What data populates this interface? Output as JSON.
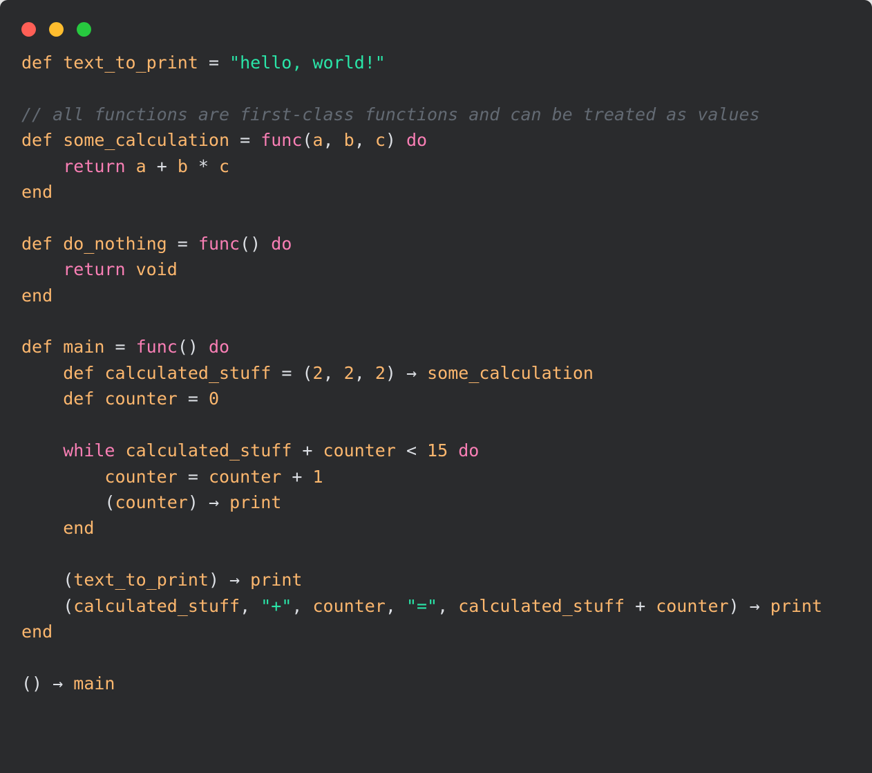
{
  "window": {
    "titlebar": {
      "buttons": [
        {
          "name": "close",
          "label": "Close",
          "color": "#ff5f56"
        },
        {
          "name": "minimize",
          "label": "Minimize",
          "color": "#ffbd2e"
        },
        {
          "name": "maximize",
          "label": "Maximize",
          "color": "#27c93f"
        }
      ]
    },
    "background_color": "#2a2b2d",
    "page_background_color": "#e4e4e4"
  },
  "theme": {
    "keyword_color": "#f97fb5",
    "identifier_color": "#fcb76e",
    "string_color": "#2ae5a8",
    "operator_color": "#dcdfe4",
    "number_color": "#fcb76e",
    "comment_color": "#636a73"
  },
  "code": {
    "language": "pseudo-lang",
    "plain_text": "def text_to_print = \"hello, world!\"\n\n// all functions are first-class functions and can be treated as values\ndef some_calculation = func(a, b, c) do\n    return a + b * c\nend\n\ndef do_nothing = func() do\n    return void\nend\n\ndef main = func() do\n    def calculated_stuff = (2, 2, 2) → some_calculation\n    def counter = 0\n\n    while calculated_stuff + counter < 15 do\n        counter = counter + 1\n        (counter) → print\n    end\n\n    (text_to_print) → print\n    (calculated_stuff, \"+\", counter, \"=\", calculated_stuff + counter) → print\nend\n\n() → main",
    "lines": [
      {
        "n": 1,
        "tokens": [
          {
            "t": "def",
            "c": "ident"
          },
          {
            "t": " ",
            "c": "op"
          },
          {
            "t": "text_to_print",
            "c": "ident"
          },
          {
            "t": " = ",
            "c": "op"
          },
          {
            "t": "\"hello, world!\"",
            "c": "str"
          }
        ]
      },
      {
        "n": 2,
        "tokens": []
      },
      {
        "n": 3,
        "tokens": [
          {
            "t": "// all functions are first-class functions and can be treated as values",
            "c": "com"
          }
        ]
      },
      {
        "n": 4,
        "tokens": [
          {
            "t": "def",
            "c": "ident"
          },
          {
            "t": " ",
            "c": "op"
          },
          {
            "t": "some_calculation",
            "c": "ident"
          },
          {
            "t": " = ",
            "c": "op"
          },
          {
            "t": "func",
            "c": "kw"
          },
          {
            "t": "(",
            "c": "op"
          },
          {
            "t": "a",
            "c": "ident"
          },
          {
            "t": ", ",
            "c": "op"
          },
          {
            "t": "b",
            "c": "ident"
          },
          {
            "t": ", ",
            "c": "op"
          },
          {
            "t": "c",
            "c": "ident"
          },
          {
            "t": ") ",
            "c": "op"
          },
          {
            "t": "do",
            "c": "kw"
          }
        ]
      },
      {
        "n": 5,
        "tokens": [
          {
            "t": "    ",
            "c": "op"
          },
          {
            "t": "return",
            "c": "kw"
          },
          {
            "t": " ",
            "c": "op"
          },
          {
            "t": "a",
            "c": "ident"
          },
          {
            "t": " + ",
            "c": "op"
          },
          {
            "t": "b",
            "c": "ident"
          },
          {
            "t": " * ",
            "c": "op"
          },
          {
            "t": "c",
            "c": "ident"
          }
        ]
      },
      {
        "n": 6,
        "tokens": [
          {
            "t": "end",
            "c": "ident"
          }
        ]
      },
      {
        "n": 7,
        "tokens": []
      },
      {
        "n": 8,
        "tokens": [
          {
            "t": "def",
            "c": "ident"
          },
          {
            "t": " ",
            "c": "op"
          },
          {
            "t": "do_nothing",
            "c": "ident"
          },
          {
            "t": " = ",
            "c": "op"
          },
          {
            "t": "func",
            "c": "kw"
          },
          {
            "t": "()",
            "c": "op"
          },
          {
            "t": " ",
            "c": "op"
          },
          {
            "t": "do",
            "c": "kw"
          }
        ]
      },
      {
        "n": 9,
        "tokens": [
          {
            "t": "    ",
            "c": "op"
          },
          {
            "t": "return",
            "c": "kw"
          },
          {
            "t": " ",
            "c": "op"
          },
          {
            "t": "void",
            "c": "ident"
          }
        ]
      },
      {
        "n": 10,
        "tokens": [
          {
            "t": "end",
            "c": "ident"
          }
        ]
      },
      {
        "n": 11,
        "tokens": []
      },
      {
        "n": 12,
        "tokens": [
          {
            "t": "def",
            "c": "ident"
          },
          {
            "t": " ",
            "c": "op"
          },
          {
            "t": "main",
            "c": "ident"
          },
          {
            "t": " = ",
            "c": "op"
          },
          {
            "t": "func",
            "c": "kw"
          },
          {
            "t": "()",
            "c": "op"
          },
          {
            "t": " ",
            "c": "op"
          },
          {
            "t": "do",
            "c": "kw"
          }
        ]
      },
      {
        "n": 13,
        "tokens": [
          {
            "t": "    ",
            "c": "op"
          },
          {
            "t": "def",
            "c": "ident"
          },
          {
            "t": " ",
            "c": "op"
          },
          {
            "t": "calculated_stuff",
            "c": "ident"
          },
          {
            "t": " = ",
            "c": "op"
          },
          {
            "t": "(",
            "c": "op"
          },
          {
            "t": "2",
            "c": "num"
          },
          {
            "t": ", ",
            "c": "op"
          },
          {
            "t": "2",
            "c": "num"
          },
          {
            "t": ", ",
            "c": "op"
          },
          {
            "t": "2",
            "c": "num"
          },
          {
            "t": ") → ",
            "c": "op"
          },
          {
            "t": "some_calculation",
            "c": "ident"
          }
        ]
      },
      {
        "n": 14,
        "tokens": [
          {
            "t": "    ",
            "c": "op"
          },
          {
            "t": "def",
            "c": "ident"
          },
          {
            "t": " ",
            "c": "op"
          },
          {
            "t": "counter",
            "c": "ident"
          },
          {
            "t": " = ",
            "c": "op"
          },
          {
            "t": "0",
            "c": "num"
          }
        ]
      },
      {
        "n": 15,
        "tokens": []
      },
      {
        "n": 16,
        "tokens": [
          {
            "t": "    ",
            "c": "op"
          },
          {
            "t": "while",
            "c": "kw"
          },
          {
            "t": " ",
            "c": "op"
          },
          {
            "t": "calculated_stuff",
            "c": "ident"
          },
          {
            "t": " + ",
            "c": "op"
          },
          {
            "t": "counter",
            "c": "ident"
          },
          {
            "t": " < ",
            "c": "op"
          },
          {
            "t": "15",
            "c": "num"
          },
          {
            "t": " ",
            "c": "op"
          },
          {
            "t": "do",
            "c": "kw"
          }
        ]
      },
      {
        "n": 17,
        "tokens": [
          {
            "t": "        ",
            "c": "op"
          },
          {
            "t": "counter",
            "c": "ident"
          },
          {
            "t": " = ",
            "c": "op"
          },
          {
            "t": "counter",
            "c": "ident"
          },
          {
            "t": " + ",
            "c": "op"
          },
          {
            "t": "1",
            "c": "num"
          }
        ]
      },
      {
        "n": 18,
        "tokens": [
          {
            "t": "        (",
            "c": "op"
          },
          {
            "t": "counter",
            "c": "ident"
          },
          {
            "t": ") → ",
            "c": "op"
          },
          {
            "t": "print",
            "c": "ident"
          }
        ]
      },
      {
        "n": 19,
        "tokens": [
          {
            "t": "    ",
            "c": "op"
          },
          {
            "t": "end",
            "c": "ident"
          }
        ]
      },
      {
        "n": 20,
        "tokens": []
      },
      {
        "n": 21,
        "tokens": [
          {
            "t": "    (",
            "c": "op"
          },
          {
            "t": "text_to_print",
            "c": "ident"
          },
          {
            "t": ") → ",
            "c": "op"
          },
          {
            "t": "print",
            "c": "ident"
          }
        ]
      },
      {
        "n": 22,
        "tokens": [
          {
            "t": "    (",
            "c": "op"
          },
          {
            "t": "calculated_stuff",
            "c": "ident"
          },
          {
            "t": ", ",
            "c": "op"
          },
          {
            "t": "\"+\"",
            "c": "str"
          },
          {
            "t": ", ",
            "c": "op"
          },
          {
            "t": "counter",
            "c": "ident"
          },
          {
            "t": ", ",
            "c": "op"
          },
          {
            "t": "\"=\"",
            "c": "str"
          },
          {
            "t": ", ",
            "c": "op"
          },
          {
            "t": "calculated_stuff",
            "c": "ident"
          },
          {
            "t": " + ",
            "c": "op"
          },
          {
            "t": "counter",
            "c": "ident"
          },
          {
            "t": ") → ",
            "c": "op"
          },
          {
            "t": "print",
            "c": "ident"
          }
        ]
      },
      {
        "n": 23,
        "tokens": [
          {
            "t": "end",
            "c": "ident"
          }
        ]
      },
      {
        "n": 24,
        "tokens": []
      },
      {
        "n": 25,
        "tokens": [
          {
            "t": "() → ",
            "c": "op"
          },
          {
            "t": "main",
            "c": "ident"
          }
        ]
      }
    ]
  }
}
